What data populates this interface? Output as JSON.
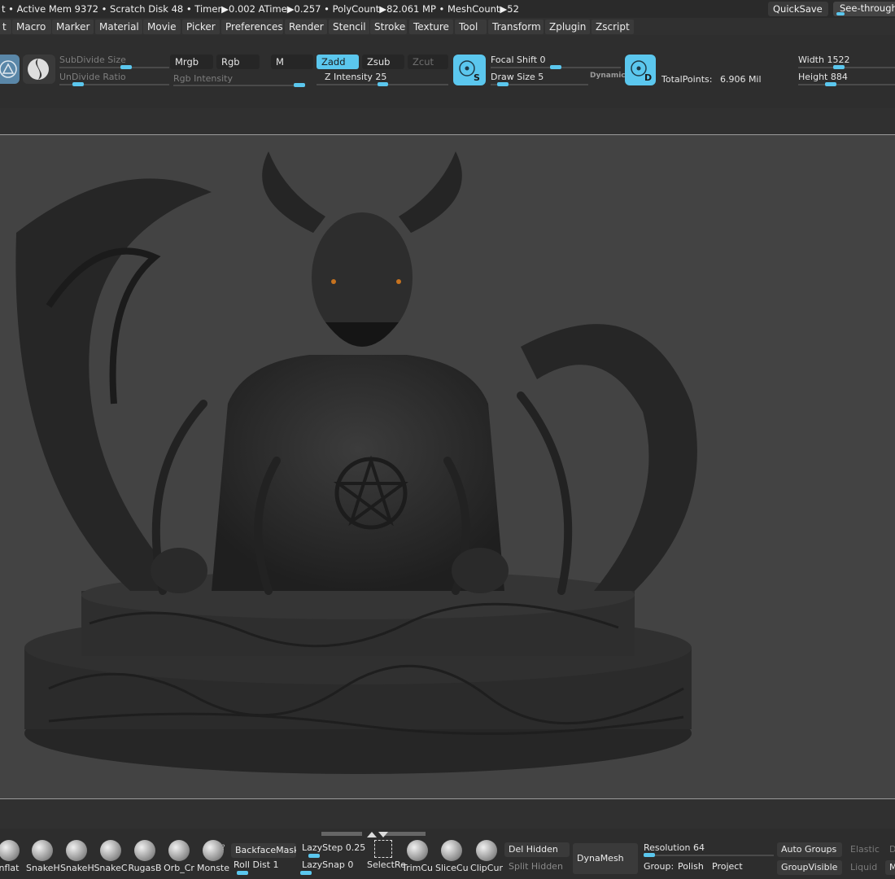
{
  "status": {
    "text": "t • Active Mem 9372 • Scratch Disk 48 • Timer▶0.002 ATime▶0.257 • PolyCount▶82.061 MP • MeshCount▶52",
    "quicksave": "QuickSave",
    "seethrough": "See-through"
  },
  "menu": [
    "t",
    "Macro",
    "Marker",
    "Material",
    "Movie",
    "Picker",
    "Preferences",
    "Render",
    "Stencil",
    "Stroke",
    "Texture",
    "Tool",
    "Transform",
    "Zplugin",
    "Zscript"
  ],
  "toolbar": {
    "subdivide_size": "SubDivide Size",
    "undivide_ratio": "UnDivide Ratio",
    "mrgb": "Mrgb",
    "rgb": "Rgb",
    "m": "M",
    "rgb_intensity": "Rgb Intensity",
    "zadd": "Zadd",
    "zsub": "Zsub",
    "zcut": "Zcut",
    "z_intensity": "Z Intensity 25",
    "focal_shift": "Focal Shift 0",
    "draw_size": "Draw Size 5",
    "dynamic": "Dynamic",
    "total_points_label": "TotalPoints:",
    "total_points_value": "6.906 Mil",
    "width": "Width 1522",
    "height": "Height 884",
    "s_letter": "S",
    "d_letter": "D"
  },
  "shelf": {
    "brushes": [
      "nflat",
      "SnakeH",
      "SnakeH",
      "SnakeC",
      "RugasB",
      "Orb_Cr",
      "Monste"
    ],
    "backface_mask": "BackfaceMask",
    "roll_dist": "Roll Dist 1",
    "lazy_step": "LazyStep 0.25",
    "lazy_snap": "LazySnap 0",
    "select_r": "SelectRe",
    "trim_cu": "TrimCu",
    "slice_cu": "SliceCu",
    "clip_cu": "ClipCur",
    "del_hidden": "Del Hidden",
    "split_hidden": "Split Hidden",
    "dynamesh": "DynaMesh",
    "resolution": "Resolution 64",
    "group": "Group:",
    "polish": "Polish",
    "project": "Project",
    "auto_groups": "Auto Groups",
    "group_visible": "GroupVisible",
    "elastic": "Elastic",
    "liquid": "Liquid",
    "d": "D",
    "m": "M",
    "question": "?"
  },
  "colors": {
    "accent": "#5bc7ee",
    "background": "#303030",
    "viewport": "#434343"
  }
}
